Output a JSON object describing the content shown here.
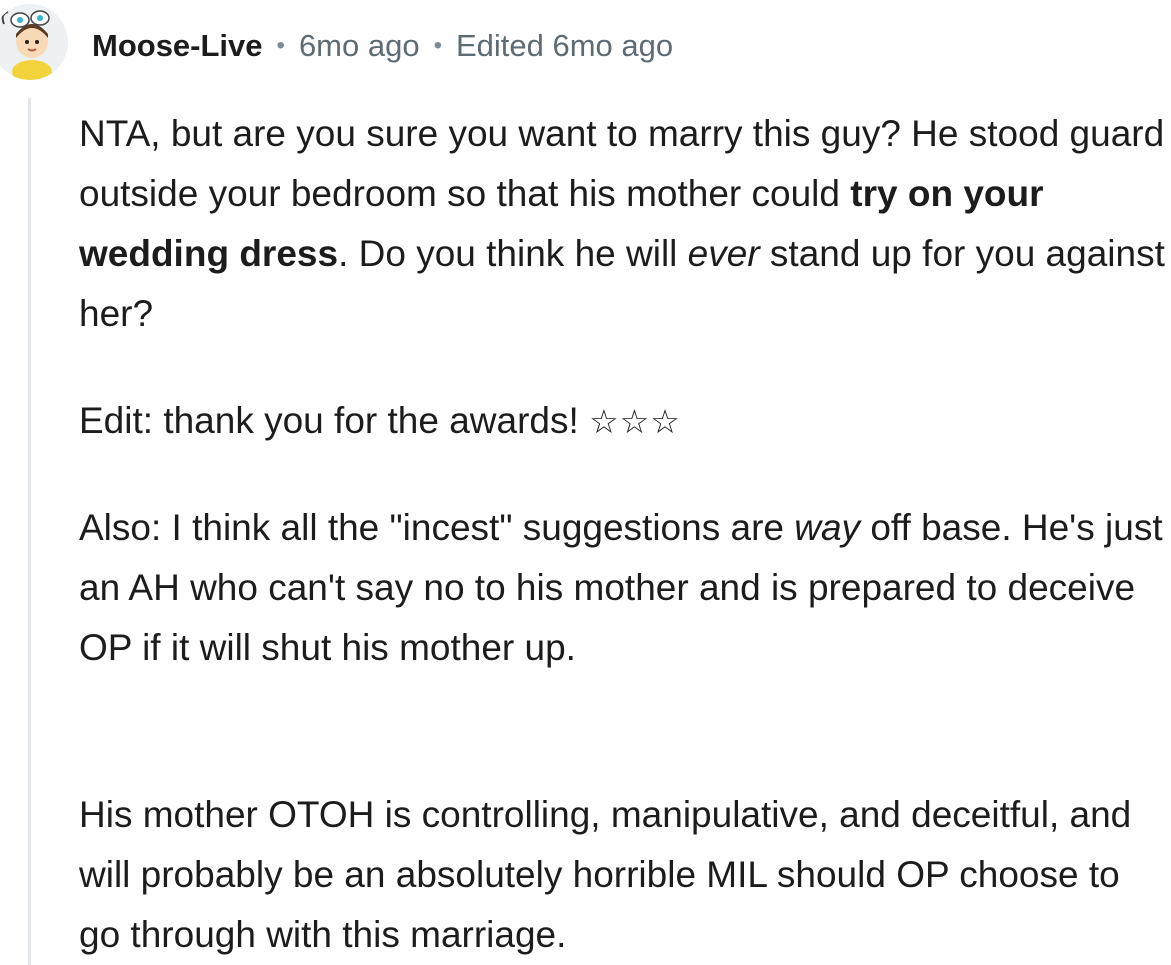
{
  "comment": {
    "author": "Moose-Live",
    "separator": "•",
    "time": "6mo ago",
    "edited": "Edited 6mo ago",
    "avatar_icon": "snoo-avatar-icon",
    "paragraphs": {
      "p1": {
        "part1": "NTA, but are you sure you want to marry this guy? He stood guard outside your bedroom so that his mother could ",
        "bold": "try on your wedding dress",
        "part2": ". Do you think he will ",
        "italic": "ever",
        "part3": " stand up for you against her?"
      },
      "p2": {
        "text": "Edit: thank you for the awards! ",
        "stars": "☆☆☆"
      },
      "p3": {
        "part1": "Also: I think all the \"incest\" suggestions are ",
        "italic": "way",
        "part2": " off base. He's just an AH who can't say no to his mother and is prepared to deceive OP if it will shut his mother up."
      },
      "p4": {
        "text": "His mother OTOH is controlling, manipulative, and deceitful, and will probably be an absolutely horrible MIL should OP choose to go through with this marriage."
      }
    }
  },
  "colors": {
    "text": "#1c1c1c",
    "meta": "#5d6b74",
    "thread_line": "#e4e7e9"
  }
}
